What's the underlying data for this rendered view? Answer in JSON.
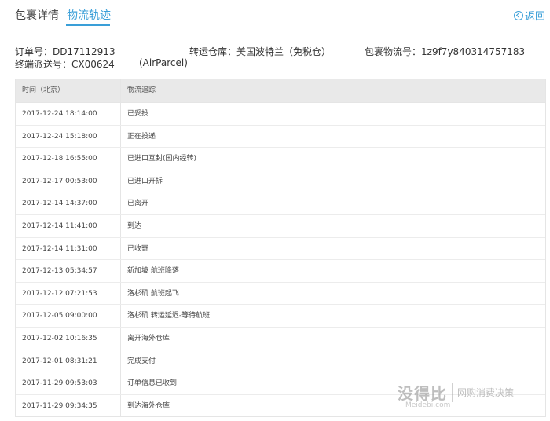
{
  "tabs": {
    "detail": "包裹详情",
    "tracking": "物流轨迹",
    "back": "返回"
  },
  "info": {
    "order_label": "订单号：",
    "order_value": "DD17112913",
    "warehouse_label": "转运仓库：",
    "warehouse_value": "美国波特兰（免税仓）",
    "parcel_label": "包裹物流号：",
    "parcel_value": "1z9f7y840314757183",
    "final_label": "终端派送号：",
    "final_value": "CX00624",
    "carrier": "(AirParcel)"
  },
  "table": {
    "headers": [
      "时间（北京）",
      "物流追踪"
    ],
    "rows": [
      [
        "2017-12-24 18:14:00",
        "已妥投"
      ],
      [
        "2017-12-24 15:18:00",
        "正在投递"
      ],
      [
        "2017-12-18 16:55:00",
        "已进口互封(国内经转)"
      ],
      [
        "2017-12-17 00:53:00",
        "已进口开拆"
      ],
      [
        "2017-12-14 14:37:00",
        "已离开"
      ],
      [
        "2017-12-14 11:41:00",
        "到达"
      ],
      [
        "2017-12-14 11:31:00",
        "已收寄"
      ],
      [
        "2017-12-13 05:34:57",
        "新加坡 航班降落"
      ],
      [
        "2017-12-12 07:21:53",
        "洛杉矶 航班起飞"
      ],
      [
        "2017-12-05 09:00:00",
        "洛杉矶 转运延迟-等待航班"
      ],
      [
        "2017-12-02 10:16:35",
        "离开海外仓库"
      ],
      [
        "2017-12-01 08:31:21",
        "完成支付"
      ],
      [
        "2017-11-29 09:53:03",
        "订单信息已收到"
      ],
      [
        "2017-11-29 09:34:35",
        "到达海外仓库"
      ]
    ]
  },
  "watermark": {
    "logo": "没得比",
    "site": "Meidebi.com",
    "slogan": "网购消费决策"
  }
}
